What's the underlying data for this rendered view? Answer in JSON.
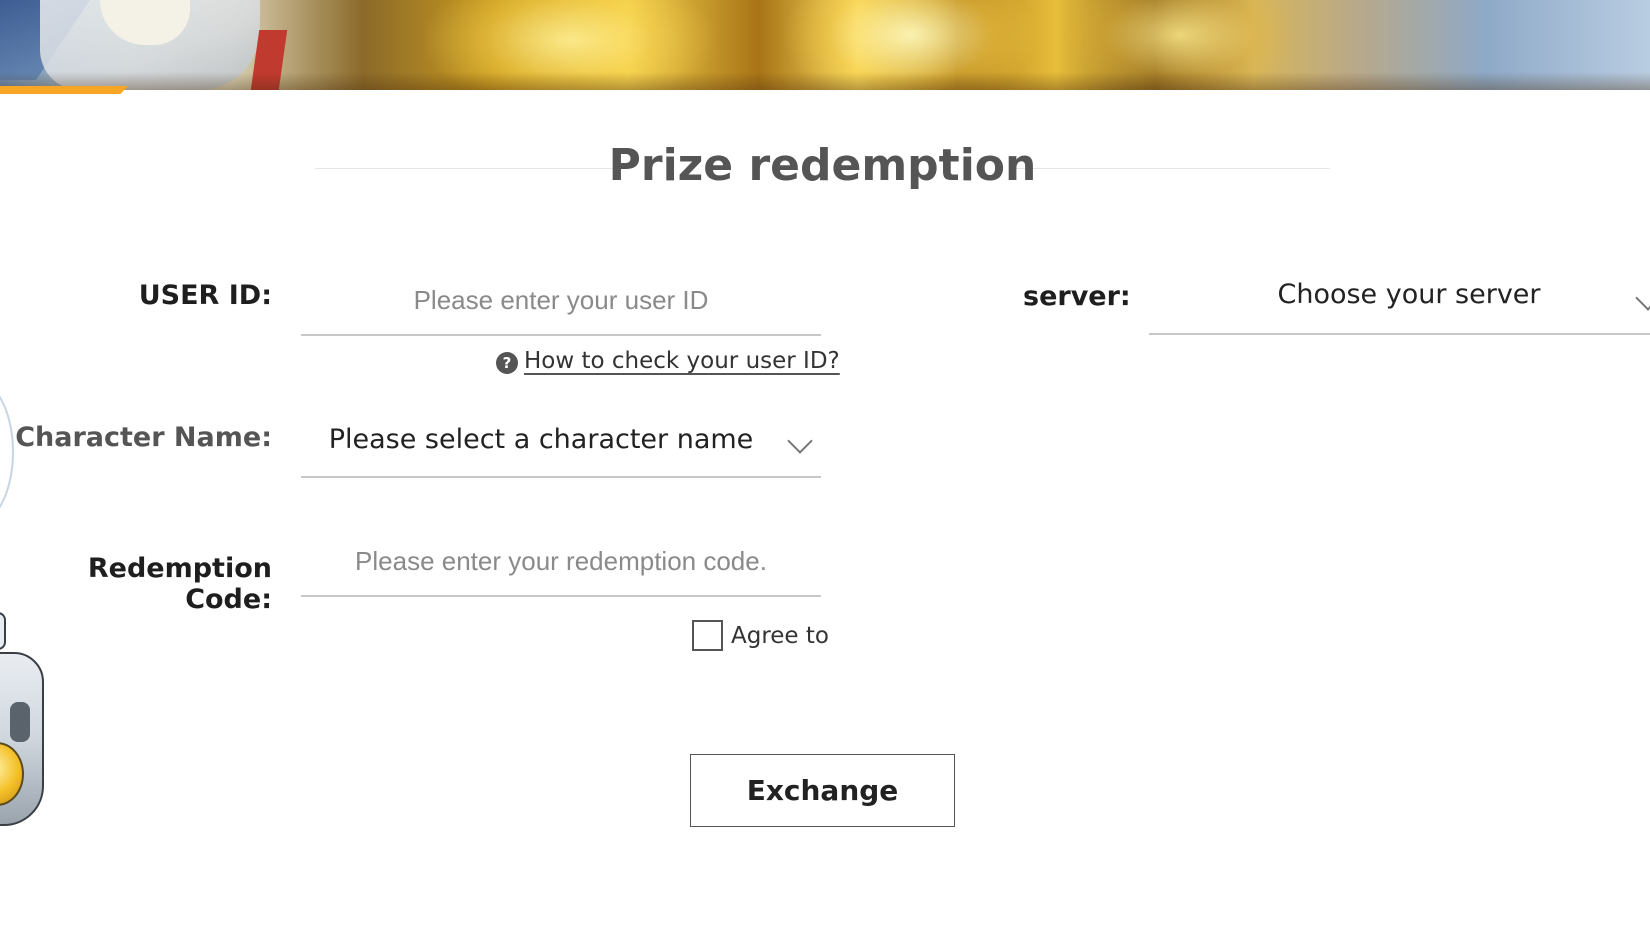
{
  "header": {
    "title": "Prize redemption"
  },
  "form": {
    "user_id": {
      "label": "USER ID:",
      "placeholder": "Please enter your user ID",
      "value": ""
    },
    "help_link": {
      "icon": "question-circle-icon",
      "label": "How to check your user ID?"
    },
    "character_name": {
      "label": "Character Name:",
      "selected": "Please select a character name"
    },
    "redemption_code": {
      "label": "Redemption Code:",
      "placeholder": "Please enter your redemption code.",
      "value": ""
    },
    "server": {
      "label": "server:",
      "selected": "Choose your server"
    },
    "agree": {
      "label": "Agree to",
      "checked": false
    },
    "exchange_button": {
      "label": "Exchange"
    }
  },
  "colors": {
    "accent": "#f6a623",
    "label_dark": "#1e1e1e",
    "label_muted": "#555555",
    "underline": "#c8c8c8"
  }
}
